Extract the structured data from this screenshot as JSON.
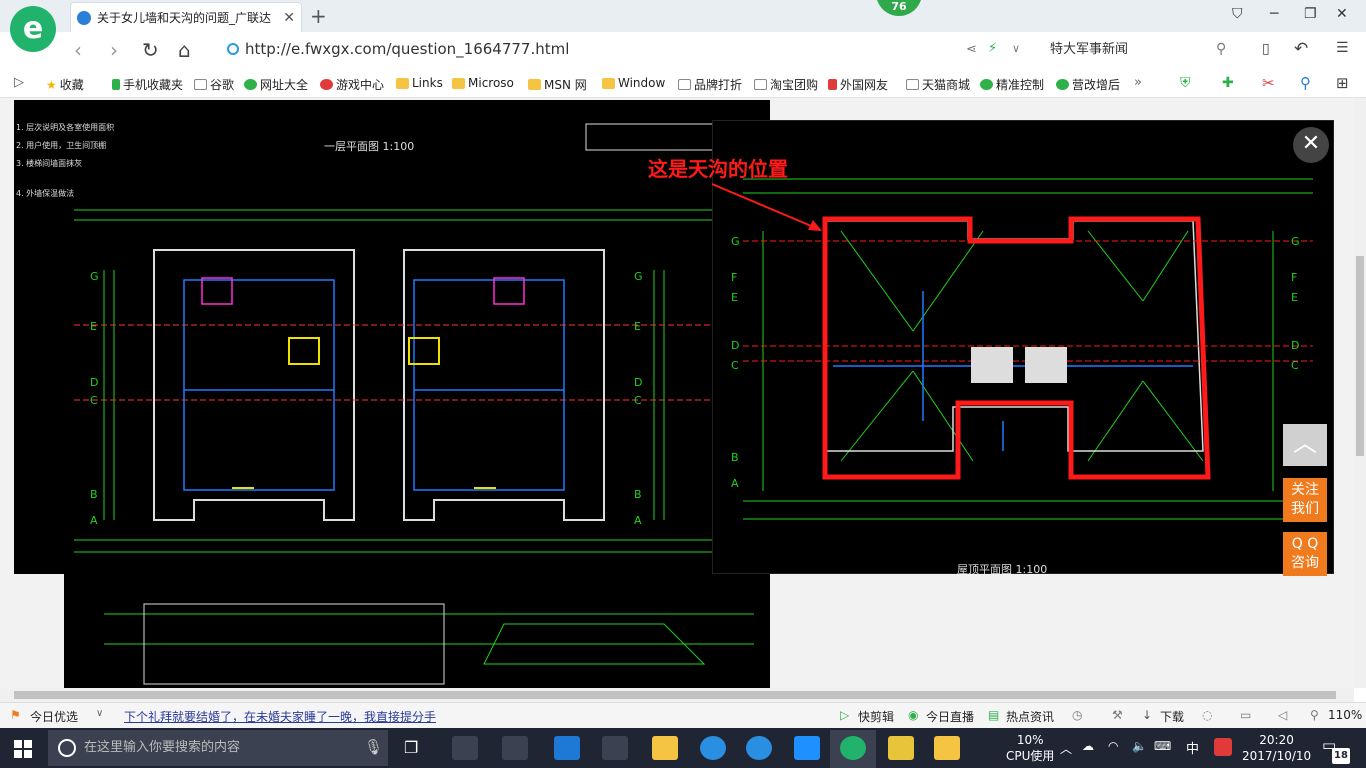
{
  "browser": {
    "logo_letter": "e",
    "tab_title": "关于女儿墙和天沟的问题_广联达",
    "tab_close": "✕",
    "new_tab": "+",
    "badge_count": "76",
    "url": "http://e.fwxgx.com/question_1664777.html",
    "search_text": "特大军事新闻"
  },
  "bookmarks": [
    {
      "label": "收藏",
      "icon": "star-icon"
    },
    {
      "label": "手机收藏夹",
      "icon": "phone-icon"
    },
    {
      "label": "谷歌",
      "icon": "page-icon"
    },
    {
      "label": "网址大全",
      "icon": "globe-icon"
    },
    {
      "label": "游戏中心",
      "icon": "game-icon"
    },
    {
      "label": "Links",
      "icon": "folder-icon"
    },
    {
      "label": "Microso",
      "icon": "folder-icon"
    },
    {
      "label": "MSN 网",
      "icon": "folder-icon"
    },
    {
      "label": "Window",
      "icon": "folder-icon"
    },
    {
      "label": "品牌打折",
      "icon": "page-icon"
    },
    {
      "label": "淘宝团购",
      "icon": "page-icon"
    },
    {
      "label": "外国网友",
      "icon": "red-icon"
    },
    {
      "label": "天猫商城",
      "icon": "page-icon"
    },
    {
      "label": "精准控制",
      "icon": "wechat-icon"
    },
    {
      "label": "营改增后",
      "icon": "wechat-icon"
    }
  ],
  "content": {
    "annotation": "这是天沟的位置",
    "close_symbol": "✕",
    "follow_label": [
      "关注",
      "我们"
    ],
    "qq_label": [
      "Q Q",
      "咨询"
    ],
    "top_symbol": "︿",
    "cad_left_title": "一层平面图 1:100",
    "cad_right_title": "屋顶平面图 1:100"
  },
  "statusbar": {
    "today_pick": "今日优选",
    "headline": "下个礼拜就要结婚了，在未婚夫家睡了一晚，我直接提分手",
    "quick_clip": "快剪辑",
    "today_live": "今日直播",
    "hot_news": "热点资讯",
    "download": "下载",
    "zoom": "110%"
  },
  "taskbar": {
    "search_placeholder": "在这里输入你要搜索的内容",
    "cpu_percent": "10%",
    "cpu_label": "CPU使用",
    "ime": "中",
    "time": "20:20",
    "date": "2017/10/10",
    "notifications": "18"
  },
  "colors": {
    "accent_green": "#21b36b",
    "cad_red": "#ff1a1a",
    "side_orange": "#f07b1e",
    "taskbar": "#1f2533"
  }
}
